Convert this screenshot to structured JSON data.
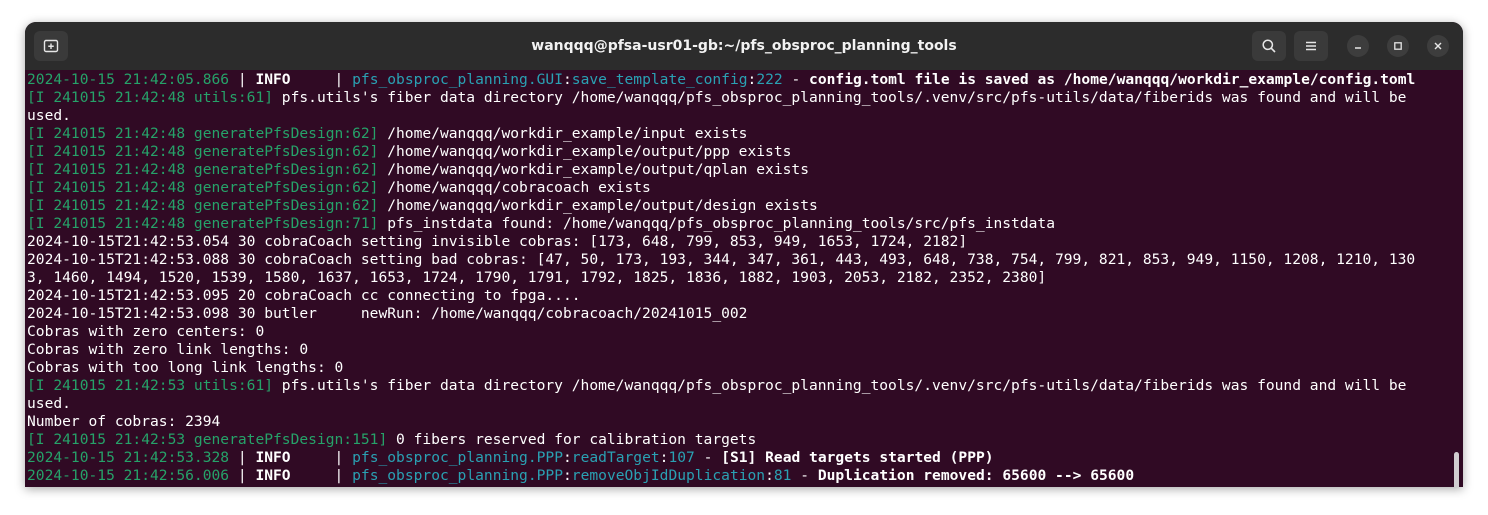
{
  "window": {
    "title": "wanqqq@pfsa-usr01-gb:~/pfs_obsproc_planning_tools",
    "icons": {
      "new_tab": "new-tab-icon",
      "search": "search-icon",
      "menu": "hamburger-menu-icon",
      "minimize": "minimize-icon",
      "maximize": "maximize-icon",
      "close": "close-icon"
    }
  },
  "terminal": {
    "colors": {
      "background": "#300a24",
      "text": "#ffffff",
      "green": "#26a269",
      "cyan": "#2aa1b3"
    },
    "lines": [
      [
        {
          "t": "2024-10-15 21:42:05.866",
          "c": "g"
        },
        {
          "t": " | "
        },
        {
          "t": "INFO",
          "b": true
        },
        {
          "t": "     | "
        },
        {
          "t": "pfs_obsproc_planning.GUI",
          "c": "c"
        },
        {
          "t": ":"
        },
        {
          "t": "save_template_config",
          "c": "c"
        },
        {
          "t": ":"
        },
        {
          "t": "222",
          "c": "c"
        },
        {
          "t": " - "
        },
        {
          "t": "config.toml file is saved as /home/wanqqq/workdir_example/config.toml",
          "b": true
        }
      ],
      [
        {
          "t": "[I 241015 21:42:48 utils:61]",
          "c": "g"
        },
        {
          "t": " pfs.utils's fiber data directory /home/wanqqq/pfs_obsproc_planning_tools/.venv/src/pfs-utils/data/fiberids was found and will be"
        }
      ],
      [
        {
          "t": "used."
        }
      ],
      [
        {
          "t": "[I 241015 21:42:48 generatePfsDesign:62]",
          "c": "g"
        },
        {
          "t": " /home/wanqqq/workdir_example/input exists"
        }
      ],
      [
        {
          "t": "[I 241015 21:42:48 generatePfsDesign:62]",
          "c": "g"
        },
        {
          "t": " /home/wanqqq/workdir_example/output/ppp exists"
        }
      ],
      [
        {
          "t": "[I 241015 21:42:48 generatePfsDesign:62]",
          "c": "g"
        },
        {
          "t": " /home/wanqqq/workdir_example/output/qplan exists"
        }
      ],
      [
        {
          "t": "[I 241015 21:42:48 generatePfsDesign:62]",
          "c": "g"
        },
        {
          "t": " /home/wanqqq/cobracoach exists"
        }
      ],
      [
        {
          "t": "[I 241015 21:42:48 generatePfsDesign:62]",
          "c": "g"
        },
        {
          "t": " /home/wanqqq/workdir_example/output/design exists"
        }
      ],
      [
        {
          "t": "[I 241015 21:42:48 generatePfsDesign:71]",
          "c": "g"
        },
        {
          "t": " pfs_instdata found: /home/wanqqq/pfs_obsproc_planning_tools/src/pfs_instdata"
        }
      ],
      [
        {
          "t": "2024-10-15T21:42:53.054 30 cobraCoach setting invisible cobras: [173, 648, 799, 853, 949, 1653, 1724, 2182]"
        }
      ],
      [
        {
          "t": "2024-10-15T21:42:53.088 30 cobraCoach setting bad cobras: [47, 50, 173, 193, 344, 347, 361, 443, 493, 648, 738, 754, 799, 821, 853, 949, 1150, 1208, 1210, 130"
        }
      ],
      [
        {
          "t": "3, 1460, 1494, 1520, 1539, 1580, 1637, 1653, 1724, 1790, 1791, 1792, 1825, 1836, 1882, 1903, 2053, 2182, 2352, 2380]"
        }
      ],
      [
        {
          "t": "2024-10-15T21:42:53.095 20 cobraCoach cc connecting to fpga...."
        }
      ],
      [
        {
          "t": "2024-10-15T21:42:53.098 30 butler     newRun: /home/wanqqq/cobracoach/20241015_002"
        }
      ],
      [
        {
          "t": "Cobras with zero centers: 0"
        }
      ],
      [
        {
          "t": "Cobras with zero link lengths: 0"
        }
      ],
      [
        {
          "t": "Cobras with too long link lengths: 0"
        }
      ],
      [
        {
          "t": "[I 241015 21:42:53 utils:61]",
          "c": "g"
        },
        {
          "t": " pfs.utils's fiber data directory /home/wanqqq/pfs_obsproc_planning_tools/.venv/src/pfs-utils/data/fiberids was found and will be"
        }
      ],
      [
        {
          "t": "used."
        }
      ],
      [
        {
          "t": "Number of cobras: 2394"
        }
      ],
      [
        {
          "t": "[I 241015 21:42:53 generatePfsDesign:151]",
          "c": "g"
        },
        {
          "t": " 0 fibers reserved for calibration targets"
        }
      ],
      [
        {
          "t": "2024-10-15 21:42:53.328",
          "c": "g"
        },
        {
          "t": " | "
        },
        {
          "t": "INFO",
          "b": true
        },
        {
          "t": "     | "
        },
        {
          "t": "pfs_obsproc_planning.PPP",
          "c": "c"
        },
        {
          "t": ":"
        },
        {
          "t": "readTarget",
          "c": "c"
        },
        {
          "t": ":"
        },
        {
          "t": "107",
          "c": "c"
        },
        {
          "t": " - "
        },
        {
          "t": "[S1] Read targets started (PPP)",
          "b": true
        }
      ],
      [
        {
          "t": "2024-10-15 21:42:56.006",
          "c": "g"
        },
        {
          "t": " | "
        },
        {
          "t": "INFO",
          "b": true
        },
        {
          "t": "     | "
        },
        {
          "t": "pfs_obsproc_planning.PPP",
          "c": "c"
        },
        {
          "t": ":"
        },
        {
          "t": "removeObjIdDuplication",
          "c": "c"
        },
        {
          "t": ":"
        },
        {
          "t": "81",
          "c": "c"
        },
        {
          "t": " - "
        },
        {
          "t": "Duplication removed: 65600 --> 65600",
          "b": true
        }
      ]
    ]
  }
}
